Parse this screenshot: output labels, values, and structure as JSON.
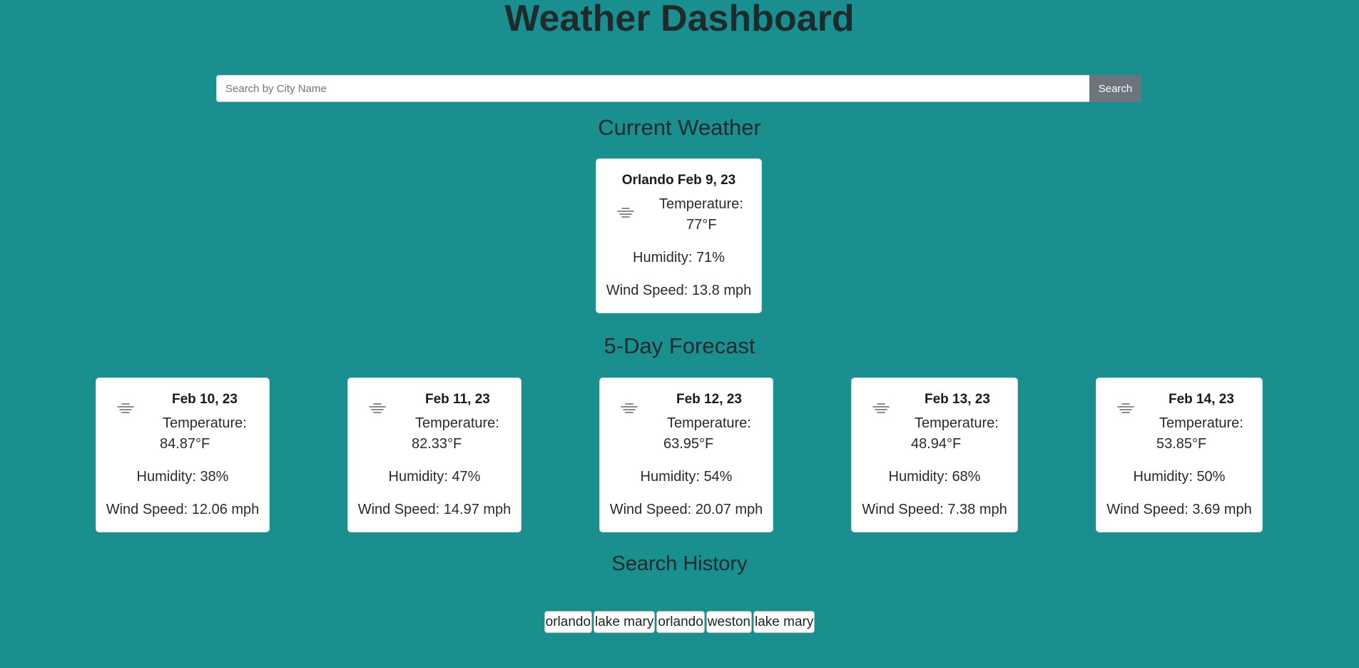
{
  "header": {
    "title": "Weather Dashboard"
  },
  "search": {
    "placeholder": "Search by City Name",
    "value": "",
    "button_label": "Search"
  },
  "current": {
    "heading": "Current Weather",
    "title": "Orlando Feb 9, 23",
    "icon": "mist-icon",
    "temp_label": "Temperature:",
    "temp_value": "77°F",
    "humidity": "Humidity: 71%",
    "wind": "Wind Speed: 13.8 mph"
  },
  "forecast": {
    "heading": "5-Day Forecast",
    "days": [
      {
        "date": "Feb 10, 23",
        "icon": "mist-icon",
        "temp_label": "Temperature:",
        "temp_value": "84.87°F",
        "humidity": "Humidity: 38%",
        "wind": "Wind Speed: 12.06 mph"
      },
      {
        "date": "Feb 11, 23",
        "icon": "mist-icon",
        "temp_label": "Temperature:",
        "temp_value": "82.33°F",
        "humidity": "Humidity: 47%",
        "wind": "Wind Speed: 14.97 mph"
      },
      {
        "date": "Feb 12, 23",
        "icon": "mist-icon",
        "temp_label": "Temperature:",
        "temp_value": "63.95°F",
        "humidity": "Humidity: 54%",
        "wind": "Wind Speed: 20.07 mph"
      },
      {
        "date": "Feb 13, 23",
        "icon": "mist-icon",
        "temp_label": "Temperature:",
        "temp_value": "48.94°F",
        "humidity": "Humidity: 68%",
        "wind": "Wind Speed: 7.38 mph"
      },
      {
        "date": "Feb 14, 23",
        "icon": "mist-icon",
        "temp_label": "Temperature:",
        "temp_value": "53.85°F",
        "humidity": "Humidity: 50%",
        "wind": "Wind Speed: 3.69 mph"
      }
    ]
  },
  "history": {
    "heading": "Search History",
    "items": [
      "orlando",
      "lake mary",
      "orlando",
      "weston",
      "lake mary"
    ]
  },
  "colors": {
    "background": "#1a8f8f",
    "search_button": "#6c757d",
    "card": "#ffffff"
  }
}
